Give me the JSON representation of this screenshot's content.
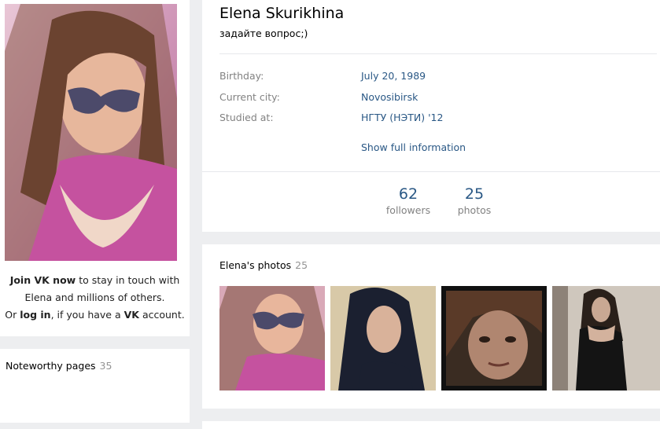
{
  "left": {
    "join": {
      "join_link": "Join VK now",
      "text1": " to stay in touch with",
      "text2": "Elena and millions of others.",
      "or_text": "Or ",
      "login_link": "log in",
      "text3": ", if you have a ",
      "vk_brand": "VK",
      "text4": " account."
    },
    "noteworthy": {
      "title": "Noteworthy pages",
      "count": "35"
    }
  },
  "profile": {
    "name": "Elena Skurikhina",
    "status": "задайте вопрос;)",
    "info": [
      {
        "label": "Birthday:",
        "value": "July 20, 1989"
      },
      {
        "label": "Current city:",
        "value": "Novosibirsk"
      },
      {
        "label": "Studied at:",
        "value": "НГТУ (НЭТИ) '12"
      }
    ],
    "show_full": "Show full information",
    "counters": [
      {
        "num": "62",
        "label": "followers"
      },
      {
        "num": "25",
        "label": "photos"
      }
    ]
  },
  "photos": {
    "title": "Elena's photos",
    "count": "25"
  }
}
